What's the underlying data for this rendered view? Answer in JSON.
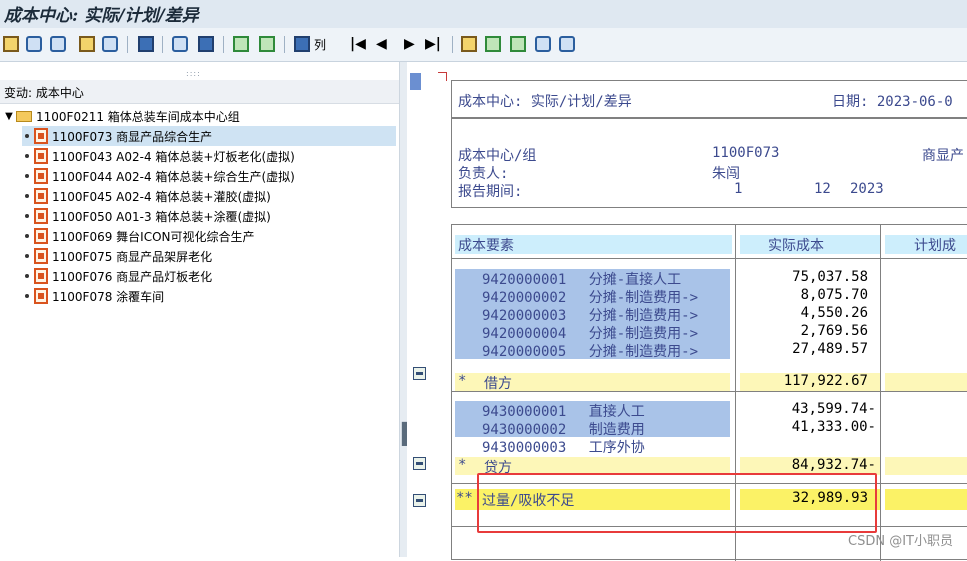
{
  "window": {
    "title": "成本中心: 实际/计划/差异"
  },
  "toolbar": {
    "icons": [
      "hierarchy-icon",
      "drill-icon",
      "settings-icon",
      "layout-icon",
      "info-icon",
      "filter-icon",
      "select-icon",
      "detail-icon",
      "sort-asc-icon",
      "sort-desc-icon",
      "find-icon"
    ],
    "find_label": "列",
    "nav": [
      "|◀",
      "◀",
      "▶",
      "▶|"
    ]
  },
  "left": {
    "grip": "::::",
    "change_label": "变动:  成本中心",
    "root": "1100F0211 箱体总装车间成本中心组",
    "items": [
      "1100F073 商显产品综合生产",
      "1100F043 A02-4 箱体总装+灯板老化(虚拟)",
      "1100F044 A02-4 箱体总装+综合生产(虚拟)",
      "1100F045 A02-4 箱体总装+灌胶(虚拟)",
      "1100F050 A01-3 箱体总装+涂覆(虚拟)",
      "1100F069 舞台ICON可视化综合生产",
      "1100F075 商显产品架屏老化",
      "1100F076 商显产品灯板老化",
      "1100F078 涂覆车间"
    ]
  },
  "report": {
    "title": "成本中心: 实际/计划/差异",
    "date_label": "日期: 2023-06-0",
    "cc_label": "成本中心/组",
    "cc_value": "1100F073",
    "cc_name": "商显产",
    "owner_label": "负责人:",
    "owner_value": "朱闯",
    "period_label": "报告期间:",
    "period_from": "1",
    "period_to": "12",
    "period_year": "2023",
    "col_element": "成本要素",
    "col_actual": "实际成本",
    "col_plan": "计划成",
    "debit_rows": [
      {
        "code": "9420000001",
        "name": "分摊-直接人工",
        "actual": "75,037.58"
      },
      {
        "code": "9420000002",
        "name": "分摊-制造费用->",
        "actual": "8,075.70"
      },
      {
        "code": "9420000003",
        "name": "分摊-制造费用->",
        "actual": "4,550.26"
      },
      {
        "code": "9420000004",
        "name": "分摊-制造费用->",
        "actual": "2,769.56"
      },
      {
        "code": "9420000005",
        "name": "分摊-制造费用->",
        "actual": "27,489.57"
      }
    ],
    "debit_total": {
      "marker": "*",
      "label": "借方",
      "actual": "117,922.67"
    },
    "credit_rows": [
      {
        "code": "9430000001",
        "name": "直接人工",
        "actual": "43,599.74-"
      },
      {
        "code": "9430000002",
        "name": "制造费用",
        "actual": "41,333.00-"
      },
      {
        "code": "9430000003",
        "name": "工序外协",
        "actual": ""
      }
    ],
    "credit_total": {
      "marker": "*",
      "label": "贷方",
      "actual": "84,932.74-"
    },
    "grand_total": {
      "marker": "**",
      "label": "过量/吸收不足",
      "actual": "32,989.93"
    }
  },
  "watermark": "CSDN @IT小职员"
}
